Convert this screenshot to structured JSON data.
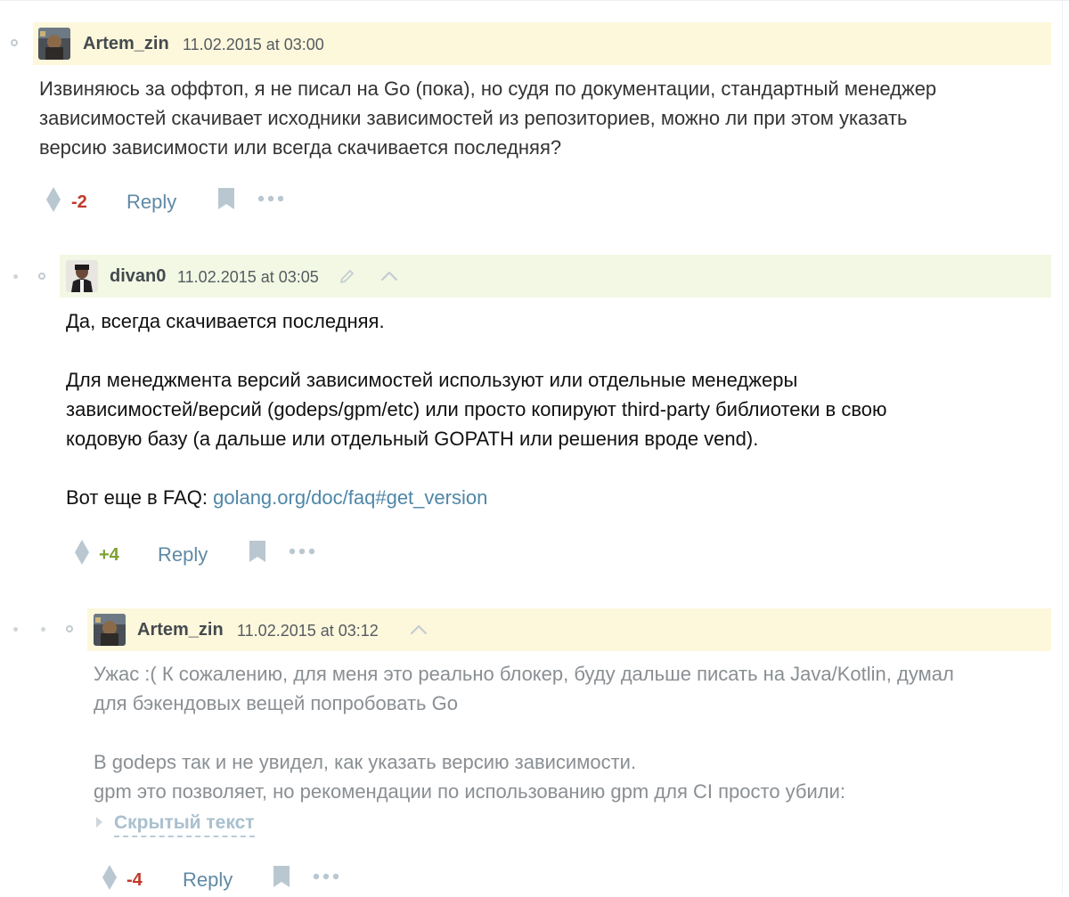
{
  "comments": [
    {
      "author": "Artem_zin",
      "date": "11.02.2015 at 03:00",
      "body": [
        "Извиняюсь за оффтоп, я не писал на Go (пока), но судя по документации, стандартный менеджер",
        "зависимостей скачивает исходники зависимостей из репозиториев, можно ли при этом указать",
        "версию зависимости или всегда скачивается последняя?"
      ],
      "score": "-2",
      "reply_label": "Reply"
    },
    {
      "author": "divan0",
      "date": "11.02.2015 at 03:05",
      "body_first": "Да, всегда скачивается последняя.",
      "body_para": [
        "Для менеджмента версий зависимостей используют или отдельные менеджеры",
        "зависимостей/версий (godeps/gpm/etc) или просто копируют third-party библиотеки в свою",
        "кодовую базу (а дальше или отдельный GOPATH или решения вроде vend)."
      ],
      "faq_prefix": "Вот еще в FAQ: ",
      "faq_link": "golang.org/doc/faq#get_version",
      "score": "+4",
      "reply_label": "Reply"
    },
    {
      "author": "Artem_zin",
      "date": "11.02.2015 at 03:12",
      "body_para1": [
        "Ужас :( К сожалению, для меня это реально блокер, буду дальше писать на Java/Kotlin, думал",
        "для бэкендовых вещей попробовать Go"
      ],
      "body_para2": [
        "В godeps так и не увидел, как указать версию зависимости.",
        "gpm это позволяет, но рекомендации по использованию gpm для CI просто убили:"
      ],
      "spoiler_label": "Скрытый текст",
      "score": "-4",
      "reply_label": "Reply"
    }
  ],
  "colors": {
    "header_yellow": "#fdf7dc",
    "header_green": "#f2f8e3",
    "negative": "#c0392b",
    "positive": "#7ba231",
    "link": "#4e87a8"
  },
  "icons": [
    "vote-icon",
    "bookmark-icon",
    "more-icon",
    "edit-icon",
    "parent-up-icon",
    "spoiler-triangle-icon"
  ]
}
